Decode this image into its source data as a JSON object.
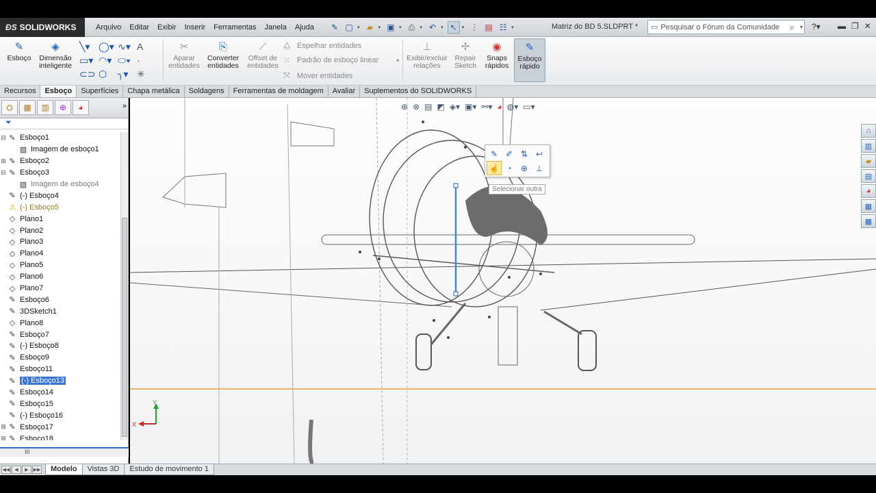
{
  "app": {
    "brand": "SOLIDWORKS",
    "document": "Matriz do BD 5.SLDPRT *"
  },
  "menu": [
    "Arquivo",
    "Editar",
    "Exibir",
    "Inserir",
    "Ferramentas",
    "Janela",
    "Ajuda"
  ],
  "search": {
    "placeholder": "Pesquisar o Fórum da Comunidade"
  },
  "ribbon": {
    "sketch": "Esboço",
    "smart_dim_1": "Dimensão",
    "smart_dim_2": "inteligente",
    "trim_1": "Aparar",
    "trim_2": "entidades",
    "convert_1": "Converter",
    "convert_2": "entidades",
    "offset_1": "Offset de",
    "offset_2": "entidades",
    "mirror": "Espelhar entidades",
    "linear_pattern": "Padrão de esboço linear",
    "move": "Mover entidades",
    "relations_1": "Exibir/excluir",
    "relations_2": "relações",
    "repair_1": "Repair",
    "repair_2": "Sketch",
    "snaps_1": "Snaps",
    "snaps_2": "rápidos",
    "quick_1": "Esboço",
    "quick_2": "rápido"
  },
  "tabs": [
    "Recursos",
    "Esboço",
    "Superfícies",
    "Chapa metálica",
    "Soldagens",
    "Ferramentas de moldagem",
    "Avaliar",
    "Suplementos do SOLIDWORKS"
  ],
  "tree": [
    {
      "label": "Esboço1",
      "expand": "⊟",
      "icon": "sketch"
    },
    {
      "label": "Imagem de esboço1",
      "indent": 1,
      "icon": "image"
    },
    {
      "label": "Esboço2",
      "expand": "⊞",
      "icon": "sketch"
    },
    {
      "label": "Esboço3",
      "expand": "⊟",
      "icon": "sketch"
    },
    {
      "label": "Imagem de esboço4",
      "indent": 1,
      "icon": "image",
      "style": "grey"
    },
    {
      "label": "(-) Esboço4",
      "icon": "sketch"
    },
    {
      "label": "(-) Esboço5",
      "icon": "warning",
      "style": "warn"
    },
    {
      "label": "Plano1",
      "icon": "plane"
    },
    {
      "label": "Plano2",
      "icon": "plane"
    },
    {
      "label": "Plano3",
      "icon": "plane"
    },
    {
      "label": "Plano4",
      "icon": "plane"
    },
    {
      "label": "Plano5",
      "icon": "plane"
    },
    {
      "label": "Plano6",
      "icon": "plane"
    },
    {
      "label": "Plano7",
      "icon": "plane"
    },
    {
      "label": "Esboço6",
      "icon": "sketch"
    },
    {
      "label": "3DSketch1",
      "icon": "sketch3d"
    },
    {
      "label": "Plano8",
      "icon": "plane"
    },
    {
      "label": "Esboço7",
      "icon": "sketch"
    },
    {
      "label": "(-) Esboço8",
      "icon": "sketch"
    },
    {
      "label": "Esboço9",
      "icon": "sketch"
    },
    {
      "label": "Esboço11",
      "icon": "sketch"
    },
    {
      "label": "(-) Esboço13",
      "icon": "sketch",
      "selected": true
    },
    {
      "label": "Esboço14",
      "icon": "sketch"
    },
    {
      "label": "Esboço15",
      "icon": "sketch"
    },
    {
      "label": "(-) Esboço16",
      "icon": "sketch"
    },
    {
      "label": "Esboço17",
      "expand": "⊞",
      "icon": "sketch"
    },
    {
      "label": "Esboço18",
      "expand": "⊞",
      "icon": "sketch"
    }
  ],
  "tooltip": "Selecionar outra",
  "bottom_tabs": [
    "Modelo",
    "Vistas 3D",
    "Estudo de movimento 1"
  ],
  "axes": {
    "x": "X",
    "y": "Y"
  }
}
